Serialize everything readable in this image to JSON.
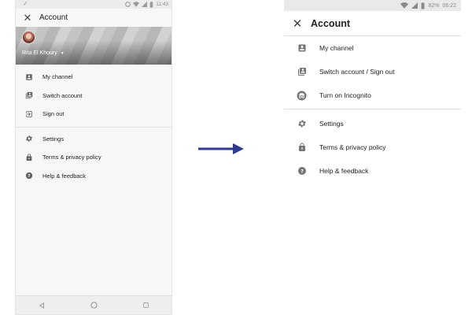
{
  "left_screen": {
    "status": {
      "left_icon": "check-mark-icon",
      "time": "11:43"
    },
    "title": "Account",
    "user_name": "Rita El Khoury",
    "menu_group1": [
      {
        "label": "My channel",
        "icon": "person-box-icon"
      },
      {
        "label": "Switch account",
        "icon": "switch-account-icon"
      },
      {
        "label": "Sign out",
        "icon": "sign-out-icon"
      }
    ],
    "menu_group2": [
      {
        "label": "Settings",
        "icon": "gear-icon"
      },
      {
        "label": "Terms & privacy policy",
        "icon": "lock-icon"
      },
      {
        "label": "Help & feedback",
        "icon": "help-icon"
      }
    ],
    "nav": [
      "back-icon",
      "home-icon",
      "recents-icon"
    ]
  },
  "right_screen": {
    "status": {
      "battery": "82%",
      "time": "06:22"
    },
    "title": "Account",
    "menu_group1": [
      {
        "label": "My channel",
        "icon": "person-box-icon"
      },
      {
        "label": "Switch account / Sign out",
        "icon": "switch-account-icon"
      },
      {
        "label": "Turn on Incognito",
        "icon": "incognito-icon"
      }
    ],
    "menu_group2": [
      {
        "label": "Settings",
        "icon": "gear-icon"
      },
      {
        "label": "Terms & privacy policy",
        "icon": "lock-icon"
      },
      {
        "label": "Help & feedback",
        "icon": "help-icon"
      }
    ]
  },
  "arrow": {
    "icon": "right-arrow-icon",
    "color": "#2e3a8c"
  }
}
